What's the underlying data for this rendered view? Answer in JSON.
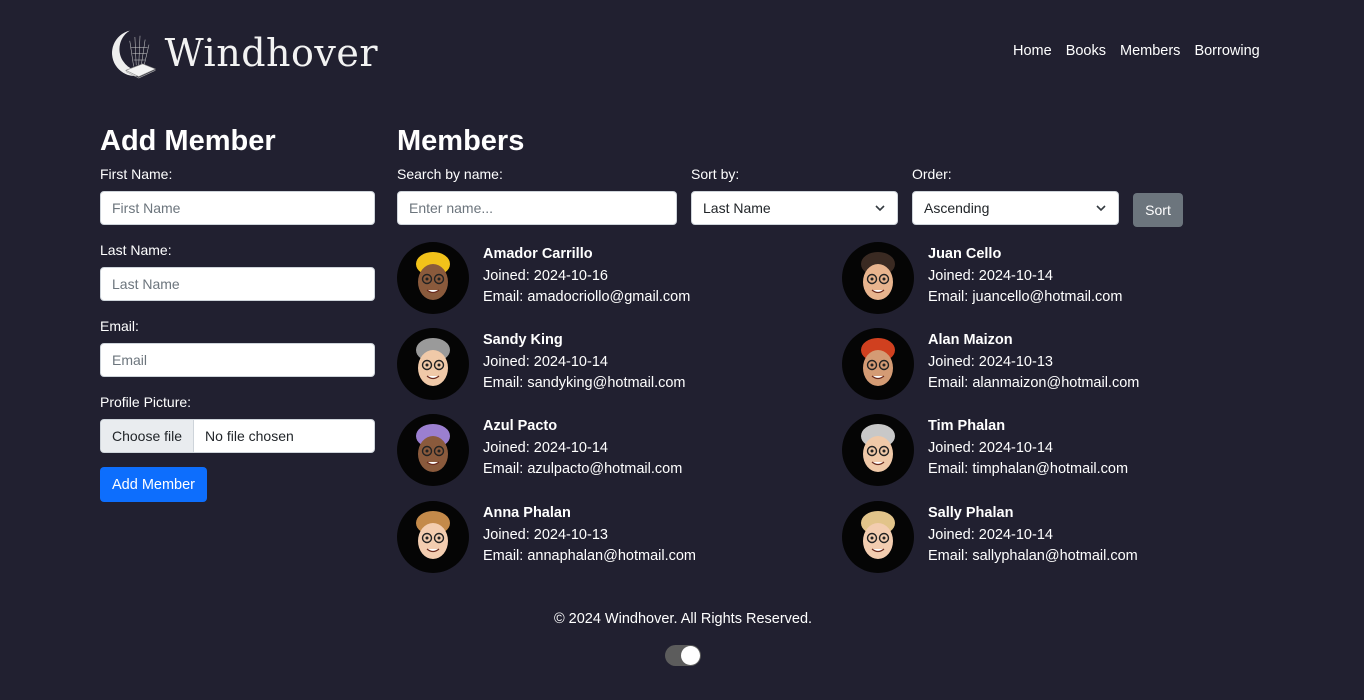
{
  "header": {
    "logo_text": "Windhover",
    "nav": [
      "Home",
      "Books",
      "Members",
      "Borrowing"
    ]
  },
  "add_member": {
    "title": "Add Member",
    "first_name_label": "First Name:",
    "first_name_placeholder": "First Name",
    "last_name_label": "Last Name:",
    "last_name_placeholder": "Last Name",
    "email_label": "Email:",
    "email_placeholder": "Email",
    "picture_label": "Profile Picture:",
    "choose_file": "Choose file",
    "no_file": "No file chosen",
    "submit_label": "Add Member"
  },
  "members": {
    "title": "Members",
    "search_label": "Search by name:",
    "search_placeholder": "Enter name...",
    "sort_label": "Sort by:",
    "sort_value": "Last Name",
    "order_label": "Order:",
    "order_value": "Ascending",
    "sort_button": "Sort",
    "list": [
      {
        "name": "Amador Carrillo",
        "joined": "Joined: 2024-10-16",
        "email": "Email: amadocriollo@gmail.com",
        "skin": "#8a5a3c",
        "hair": "#f2c21a"
      },
      {
        "name": "Juan Cello",
        "joined": "Joined: 2024-10-14",
        "email": "Email: juancello@hotmail.com",
        "skin": "#e8b48e",
        "hair": "#3a2a22"
      },
      {
        "name": "Sandy King",
        "joined": "Joined: 2024-10-14",
        "email": "Email: sandyking@hotmail.com",
        "skin": "#f0c9a8",
        "hair": "#9a9a9a"
      },
      {
        "name": "Alan Maizon",
        "joined": "Joined: 2024-10-13",
        "email": "Email: alanmaizon@hotmail.com",
        "skin": "#d49b74",
        "hair": "#d0401f"
      },
      {
        "name": "Azul Pacto",
        "joined": "Joined: 2024-10-14",
        "email": "Email: azulpacto@hotmail.com",
        "skin": "#8a5a3c",
        "hair": "#9b7fd0"
      },
      {
        "name": "Tim Phalan",
        "joined": "Joined: 2024-10-14",
        "email": "Email: timphalan@hotmail.com",
        "skin": "#f0c9a8",
        "hair": "#c8c8c8"
      },
      {
        "name": "Anna Phalan",
        "joined": "Joined: 2024-10-13",
        "email": "Email: annaphalan@hotmail.com",
        "skin": "#f3cdb0",
        "hair": "#c48a4a"
      },
      {
        "name": "Sally Phalan",
        "joined": "Joined: 2024-10-14",
        "email": "Email: sallyphalan@hotmail.com",
        "skin": "#f3cdb0",
        "hair": "#e2c48a"
      }
    ]
  },
  "footer": {
    "copyright": "© 2024 Windhover. All Rights Reserved."
  },
  "theme_toggle": {
    "on": true
  }
}
